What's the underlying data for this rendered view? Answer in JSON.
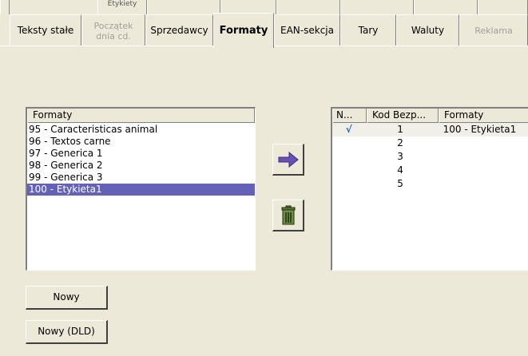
{
  "tabs": {
    "top_row_stub": "Etykiety",
    "items": [
      {
        "label": "Teksty stałe"
      },
      {
        "label": "Początek dnia cd."
      },
      {
        "label": "Sprzedawcy"
      },
      {
        "label": "Formaty"
      },
      {
        "label": "EAN-sekcja"
      },
      {
        "label": "Tary"
      },
      {
        "label": "Waluty"
      },
      {
        "label": "Reklama"
      }
    ]
  },
  "left_list": {
    "header": "Formaty",
    "items": [
      "95 - Caracteristicas animal",
      "96 - Textos carne",
      "97 - Generica 1",
      "98 - Generica 2",
      "99 - Generica 3",
      "100 - Etykieta1"
    ],
    "selected_index": 5
  },
  "actions": {
    "add_icon": "arrow-right-icon",
    "delete_icon": "trash-icon"
  },
  "right_table": {
    "headers": [
      "N...",
      "Kod Bezp...",
      "Formaty"
    ],
    "rows": [
      {
        "check": "√",
        "code": "1",
        "format": "100 - Etykieta1"
      },
      {
        "check": "",
        "code": "2",
        "format": ""
      },
      {
        "check": "",
        "code": "3",
        "format": ""
      },
      {
        "check": "",
        "code": "4",
        "format": ""
      },
      {
        "check": "",
        "code": "5",
        "format": ""
      }
    ]
  },
  "buttons": {
    "new": "Nowy",
    "new_dld": "Nowy (DLD)"
  },
  "colors": {
    "selection": "#6462b8",
    "arrow": "#6a4fb5"
  }
}
